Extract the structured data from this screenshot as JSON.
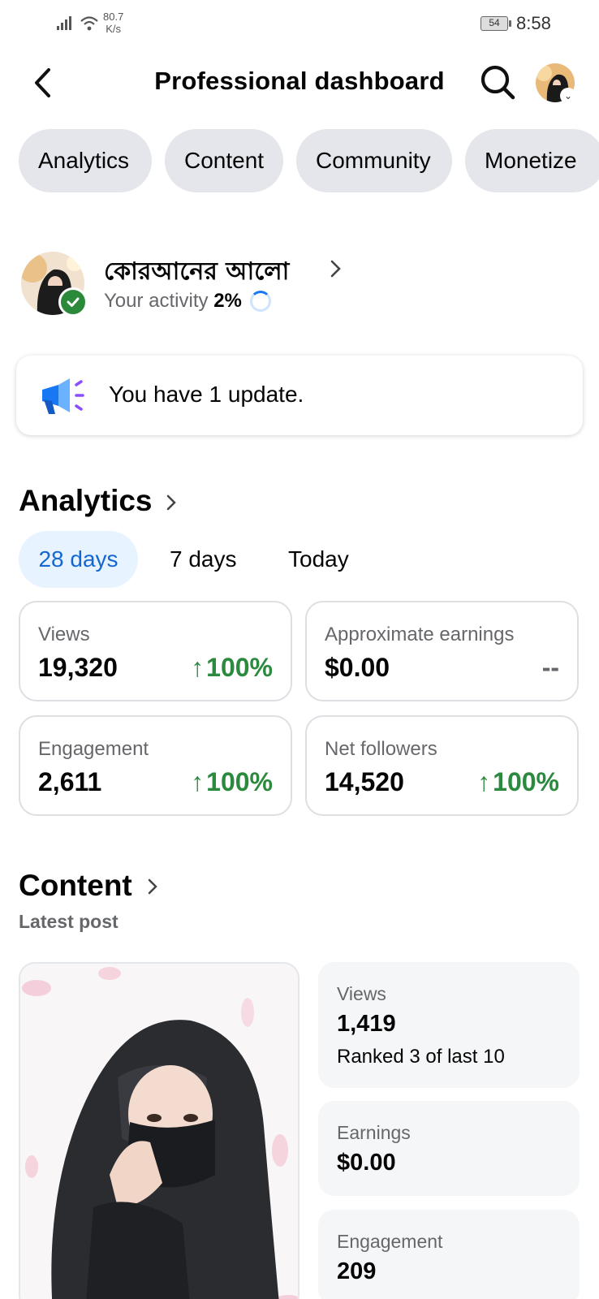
{
  "status_bar": {
    "net_speed_value": "80.7",
    "net_speed_unit": "K/s",
    "battery": "54",
    "time": "8:58"
  },
  "header": {
    "title": "Professional dashboard"
  },
  "tabs": [
    {
      "label": "Analytics"
    },
    {
      "label": "Content"
    },
    {
      "label": "Community"
    },
    {
      "label": "Monetize"
    }
  ],
  "profile": {
    "name": "কোরআনের আলো",
    "activity_label": "Your activity",
    "activity_value": "2%"
  },
  "update": {
    "text": "You have 1 update."
  },
  "analytics": {
    "title": "Analytics",
    "ranges": [
      "28 days",
      "7 days",
      "Today"
    ],
    "selected_range": "28 days",
    "metrics": [
      {
        "label": "Views",
        "value": "19,320",
        "change": "100%"
      },
      {
        "label": "Approximate earnings",
        "value": "$0.00",
        "change": "--"
      },
      {
        "label": "Engagement",
        "value": "2,611",
        "change": "100%"
      },
      {
        "label": "Net followers",
        "value": "14,520",
        "change": "100%"
      }
    ]
  },
  "content": {
    "title": "Content",
    "latest_label": "Latest post",
    "stats": [
      {
        "label": "Views",
        "value": "1,419",
        "sub": "Ranked 3 of last 10"
      },
      {
        "label": "Earnings",
        "value": "$0.00"
      },
      {
        "label": "Engagement",
        "value": "209"
      }
    ]
  },
  "colors": {
    "positive": "#2b8a3e",
    "accent": "#1467d2",
    "pill_bg": "#e4e6eb"
  },
  "icons": [
    "back-arrow-icon",
    "search-icon",
    "chevron-right-icon",
    "megaphone-icon",
    "verified-check-icon",
    "arrow-up-icon"
  ]
}
